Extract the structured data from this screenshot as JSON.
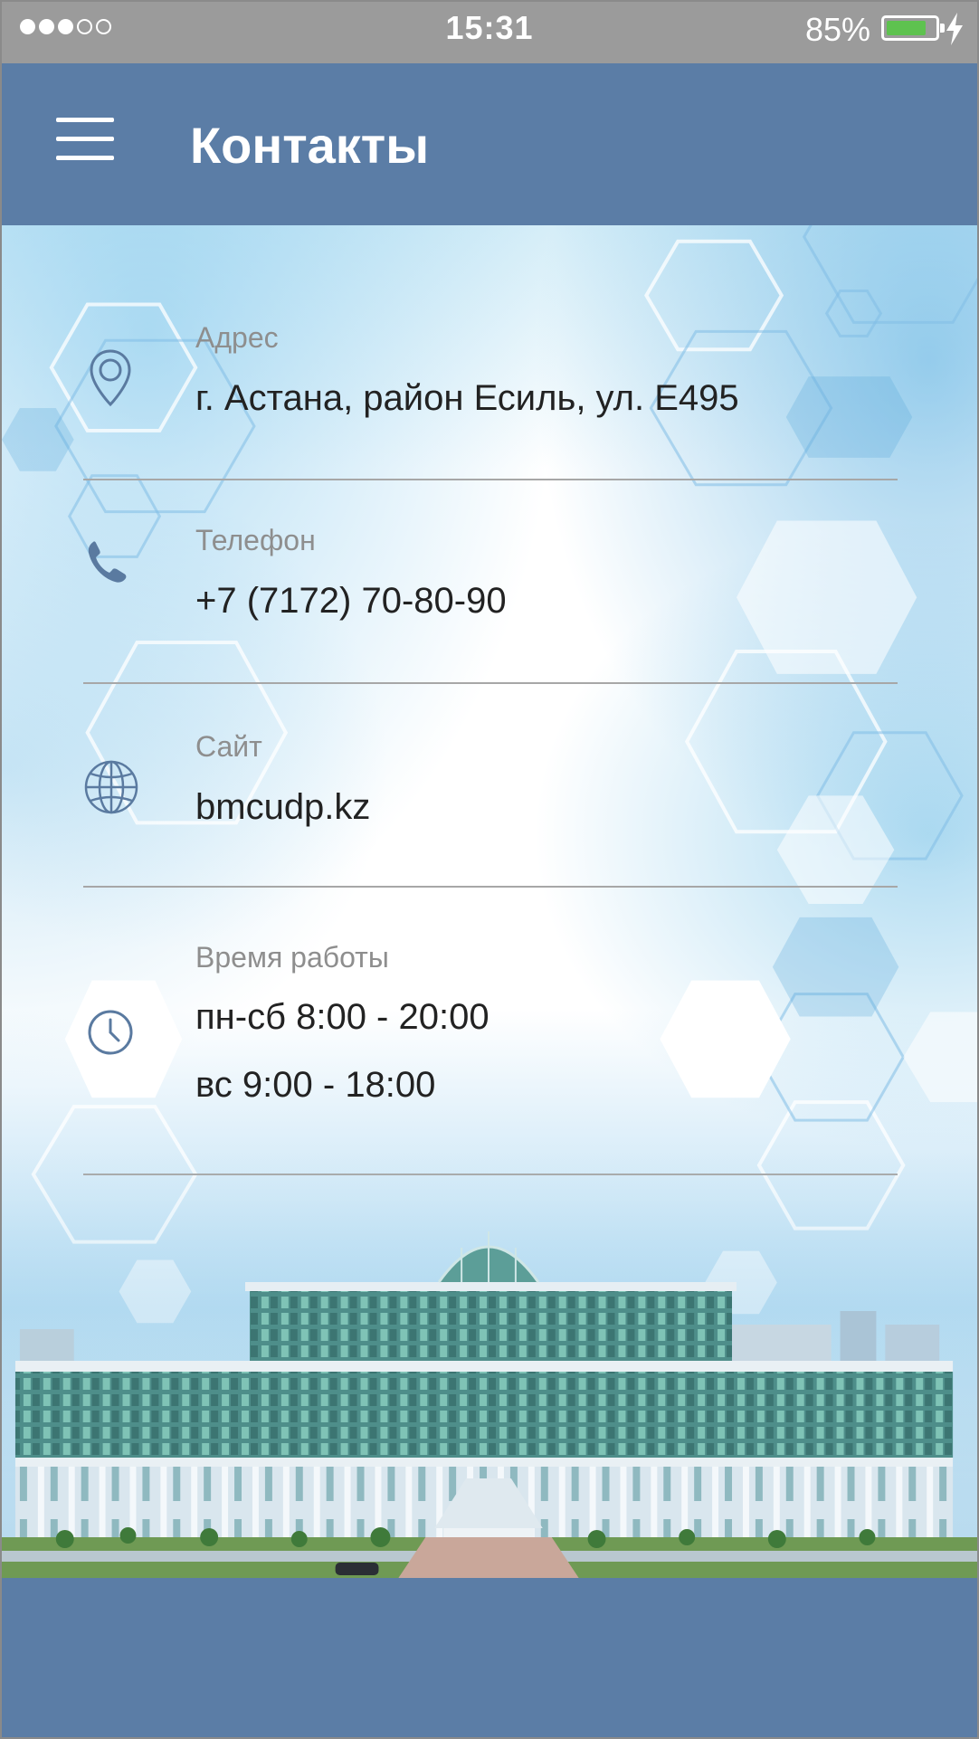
{
  "status_bar": {
    "signal_dots": [
      "full",
      "full",
      "full",
      "empty",
      "empty"
    ],
    "time": "15:31",
    "battery_percent": "85%",
    "battery_level": 0.85,
    "battery_color": "#5ec24f"
  },
  "header": {
    "title": "Контакты",
    "menu_icon": "hamburger-menu-icon",
    "background": "#5b7da6"
  },
  "contacts": [
    {
      "icon": "location-pin-icon",
      "label": "Адрес",
      "values": [
        "г. Астана, район Есиль, ул. Е495"
      ]
    },
    {
      "icon": "phone-icon",
      "label": "Телефон",
      "values": [
        "+7 (7172) 70-80-90"
      ]
    },
    {
      "icon": "globe-icon",
      "label": "Сайт",
      "values": [
        "bmcudp.kz"
      ]
    },
    {
      "icon": "clock-icon",
      "label": "Время работы",
      "values": [
        "пн-сб 8:00 - 20:00",
        "вс 9:00 - 18:00"
      ]
    }
  ],
  "colors": {
    "accent": "#5b7da6",
    "icon": "#5a7aa0",
    "label": "#8e8e8e",
    "value": "#222222",
    "divider": "#a7a7a7"
  }
}
